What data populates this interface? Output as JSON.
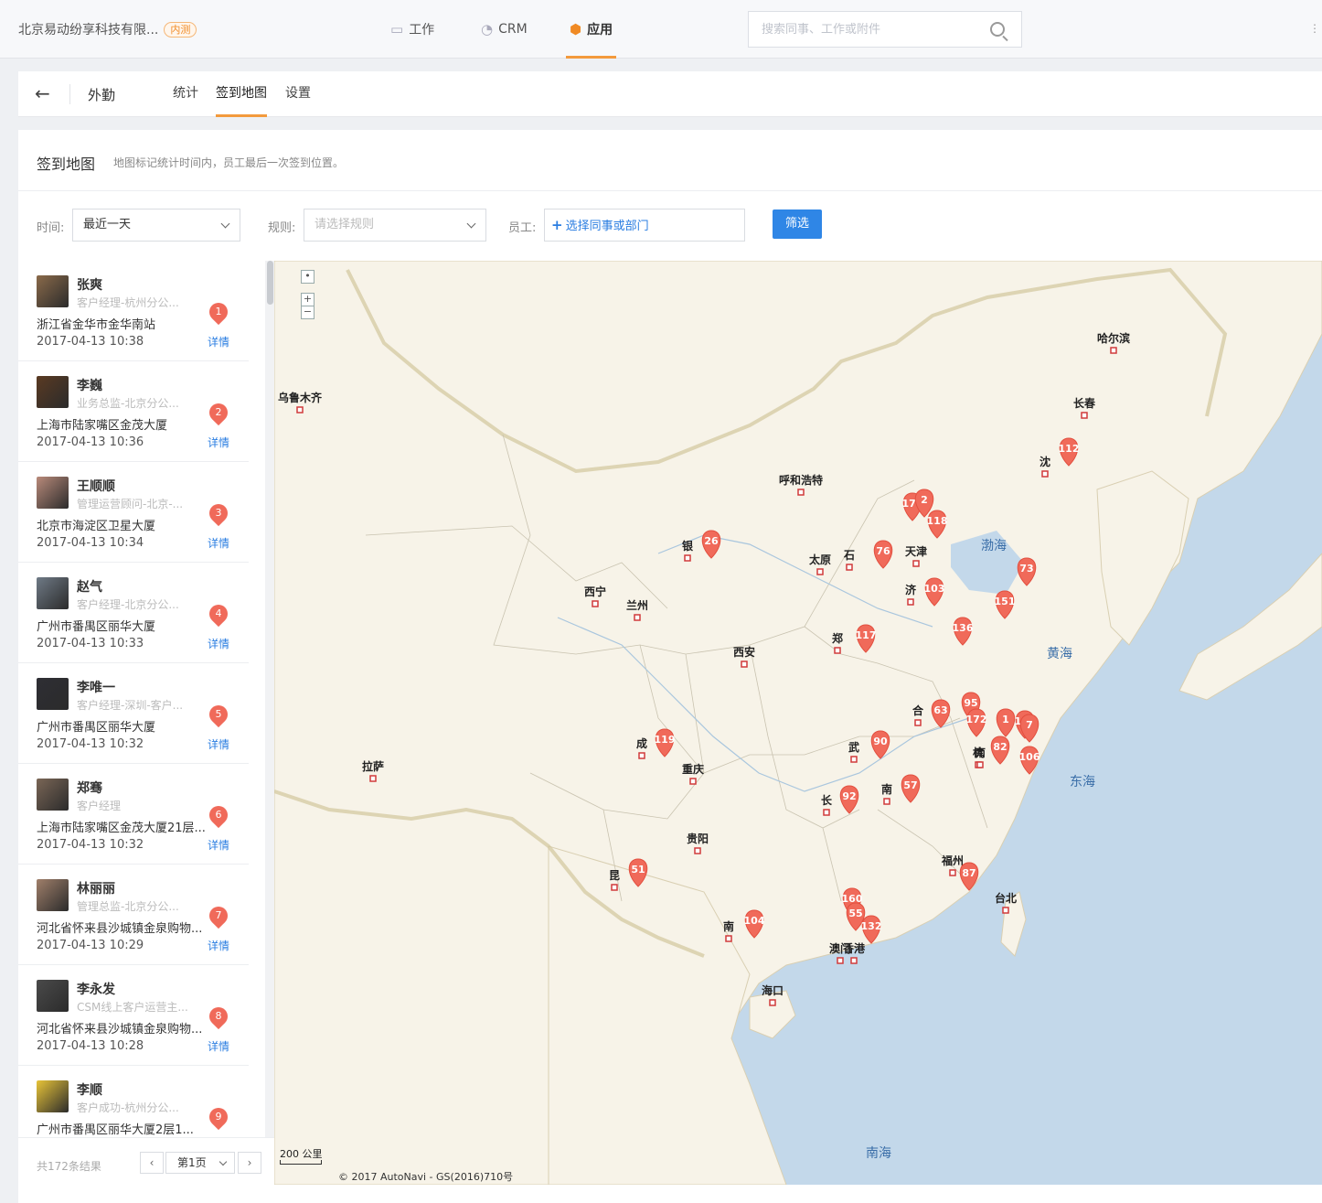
{
  "topbar": {
    "company": "北京易动纷享科技有限...",
    "badge": "内测",
    "nav": [
      {
        "label": "工作",
        "icon": "work-icon"
      },
      {
        "label": "CRM",
        "icon": "crm-icon"
      },
      {
        "label": "应用",
        "icon": "app-cube-icon",
        "active": true
      }
    ],
    "search_placeholder": "搜索同事、工作或附件"
  },
  "subnav": {
    "back_symbol": "←",
    "title": "外勤",
    "tabs": [
      "统计",
      "签到地图",
      "设置"
    ],
    "active_tab": "签到地图"
  },
  "header": {
    "title": "签到地图",
    "desc": "地图标记统计时间内，员工最后一次签到位置。"
  },
  "filters": {
    "time_label": "时间:",
    "time_value": "最近一天",
    "rule_label": "规则:",
    "rule_placeholder": "请选择规则",
    "staff_label": "员工:",
    "staff_picker": "选择同事或部门",
    "filter_button": "筛选"
  },
  "list": {
    "detail_label": "详情",
    "items": [
      {
        "name": "张爽",
        "role": "客户经理-杭州分公...",
        "addr": "浙江省金华市金华南站",
        "time": "2017-04-13 10:38",
        "num": "1",
        "color": "#8a6a4a"
      },
      {
        "name": "李巍",
        "role": "业务总监-北京分公...",
        "addr": "上海市陆家嘴区金茂大厦",
        "time": "2017-04-13 10:36",
        "num": "2",
        "color": "#5a3a22"
      },
      {
        "name": "王顺顺",
        "role": "管理运营顾问-北京-...",
        "addr": "北京市海淀区卫星大厦",
        "time": "2017-04-13 10:34",
        "num": "3",
        "color": "#b98a7a"
      },
      {
        "name": "赵气",
        "role": "客户经理-北京分公...",
        "addr": "广州市番禺区丽华大厦",
        "time": "2017-04-13 10:33",
        "num": "4",
        "color": "#6f7a86"
      },
      {
        "name": "李唯一",
        "role": "客户经理-深圳-客户...",
        "addr": "广州市番禺区丽华大厦",
        "time": "2017-04-13 10:32",
        "num": "5",
        "color": "#2e2e34"
      },
      {
        "name": "郑骞",
        "role": "客户经理",
        "addr": "上海市陆家嘴区金茂大厦21层...",
        "time": "2017-04-13 10:32",
        "num": "6",
        "color": "#7a6656"
      },
      {
        "name": "林丽丽",
        "role": "管理总监-北京分公...",
        "addr": "河北省怀来县沙城镇金泉购物...",
        "time": "2017-04-13 10:29",
        "num": "7",
        "color": "#a07f6a"
      },
      {
        "name": "李永发",
        "role": "CSM线上客户运营主...",
        "addr": "河北省怀来县沙城镇金泉购物...",
        "time": "2017-04-13 10:28",
        "num": "8",
        "color": "#4a4a4a"
      },
      {
        "name": "李顺",
        "role": "客户成功-杭州分公...",
        "addr": "广州市番禺区丽华大厦2层1...",
        "time": "",
        "num": "9",
        "color": "#e8c438"
      }
    ]
  },
  "pager": {
    "total": "共172条结果",
    "prev": "‹",
    "page": "第1页",
    "next": "›"
  },
  "map": {
    "cities": [
      {
        "name": "乌鲁木齐"
      },
      {
        "name": "哈尔滨"
      },
      {
        "name": "长春"
      },
      {
        "name": "沈"
      },
      {
        "name": "呼和浩特"
      },
      {
        "name": "天津"
      },
      {
        "name": "太原"
      },
      {
        "name": "石"
      },
      {
        "name": "西宁"
      },
      {
        "name": "兰州"
      },
      {
        "name": "银"
      },
      {
        "name": "西安"
      },
      {
        "name": "济"
      },
      {
        "name": "郑"
      },
      {
        "name": "拉萨"
      },
      {
        "name": "成"
      },
      {
        "name": "重庆"
      },
      {
        "name": "武"
      },
      {
        "name": "合"
      },
      {
        "name": "南"
      },
      {
        "name": "杭"
      },
      {
        "name": "长"
      },
      {
        "name": "南"
      },
      {
        "name": "贵阳"
      },
      {
        "name": "昆"
      },
      {
        "name": "南"
      },
      {
        "name": "福州"
      },
      {
        "name": "台北"
      },
      {
        "name": "澳门"
      },
      {
        "name": "香港"
      },
      {
        "name": "海口"
      }
    ],
    "seas": [
      "渤海",
      "黄海",
      "东海",
      "南海"
    ],
    "markers": [
      "112",
      "171",
      "2",
      "118",
      "76",
      "26",
      "73",
      "103",
      "151",
      "117",
      "136",
      "63",
      "95",
      "172",
      "1",
      "169",
      "7",
      "82",
      "106",
      "119",
      "90",
      "57",
      "92",
      "51",
      "87",
      "160",
      "55",
      "132",
      "104"
    ],
    "scale": "200 公里",
    "copyright": "© 2017 AutoNavi - GS(2016)710号",
    "colors": {
      "land": "#f7f3e8",
      "water": "#c3d8ea",
      "marker": "#f06a5a"
    }
  }
}
